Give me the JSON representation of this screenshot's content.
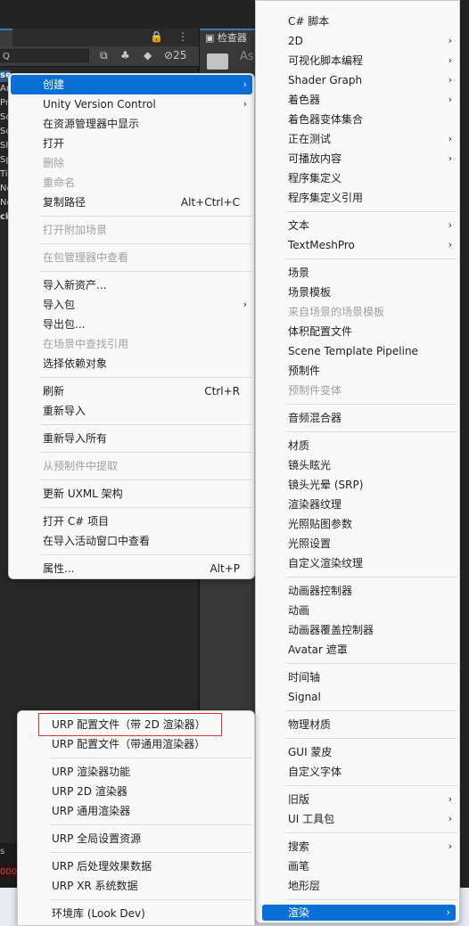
{
  "editor": {
    "inspector_tab": "检查器",
    "inspector_label": "As",
    "visible_count": "25",
    "bottom_text": "s",
    "error_text": "000"
  },
  "hierarchy": {
    "search_placeholder": "Q",
    "items": [
      "se",
      "Ar",
      "Pr",
      "Sc",
      "Sc",
      "Sh",
      "Sp",
      "Ti",
      "Ne",
      "Ne",
      "ck"
    ]
  },
  "context_menu": {
    "items": [
      {
        "label": "创建",
        "arrow": true,
        "highlight": true
      },
      {
        "label": "Unity Version Control",
        "arrow": true
      },
      {
        "label": "在资源管理器中显示"
      },
      {
        "label": "打开"
      },
      {
        "label": "删除",
        "disabled": true
      },
      {
        "label": "重命名",
        "disabled": true
      },
      {
        "label": "复制路径",
        "shortcut": "Alt+Ctrl+C"
      },
      {
        "label": "打开附加场景",
        "disabled": true
      },
      {
        "label": "在包管理器中查看",
        "disabled": true
      },
      {
        "label": "导入新资产..."
      },
      {
        "label": "导入包",
        "arrow": true
      },
      {
        "label": "导出包..."
      },
      {
        "label": "在场景中查找引用",
        "disabled": true
      },
      {
        "label": "选择依赖对象"
      },
      {
        "label": "刷新",
        "shortcut": "Ctrl+R"
      },
      {
        "label": "重新导入"
      },
      {
        "label": "重新导入所有"
      },
      {
        "label": "从预制件中提取",
        "disabled": true
      },
      {
        "label": "更新 UXML 架构"
      },
      {
        "label": "打开 C# 项目"
      },
      {
        "label": "在导入活动窗口中查看"
      },
      {
        "label": "属性...",
        "shortcut": "Alt+P"
      }
    ]
  },
  "create_menu": {
    "items": [
      {
        "label": "C# 脚本"
      },
      {
        "label": "2D",
        "arrow": true
      },
      {
        "label": "可视化脚本编程",
        "arrow": true
      },
      {
        "label": "Shader Graph",
        "arrow": true
      },
      {
        "label": "着色器",
        "arrow": true
      },
      {
        "label": "着色器变体集合"
      },
      {
        "label": "正在测试",
        "arrow": true
      },
      {
        "label": "可播放内容",
        "arrow": true
      },
      {
        "label": "程序集定义"
      },
      {
        "label": "程序集定义引用"
      },
      {
        "label": "文本",
        "arrow": true
      },
      {
        "label": "TextMeshPro",
        "arrow": true
      },
      {
        "label": "场景"
      },
      {
        "label": "场景模板"
      },
      {
        "label": "来自场景的场景模板",
        "disabled": true
      },
      {
        "label": "体积配置文件"
      },
      {
        "label": "Scene Template Pipeline"
      },
      {
        "label": "预制件"
      },
      {
        "label": "预制件变体",
        "disabled": true
      },
      {
        "label": "音频混合器"
      },
      {
        "label": "材质"
      },
      {
        "label": "镜头眩光"
      },
      {
        "label": "镜头光晕 (SRP)"
      },
      {
        "label": "渲染器纹理"
      },
      {
        "label": "光照贴图参数"
      },
      {
        "label": "光照设置"
      },
      {
        "label": "自定义渲染纹理"
      },
      {
        "label": "动画器控制器"
      },
      {
        "label": "动画"
      },
      {
        "label": "动画器覆盖控制器"
      },
      {
        "label": "Avatar 遮罩"
      },
      {
        "label": "时间轴"
      },
      {
        "label": "Signal"
      },
      {
        "label": "物理材质"
      },
      {
        "label": "GUI 蒙皮"
      },
      {
        "label": "自定义字体"
      },
      {
        "label": "旧版",
        "arrow": true
      },
      {
        "label": "UI 工具包",
        "arrow": true
      },
      {
        "label": "搜索",
        "arrow": true
      },
      {
        "label": "画笔"
      },
      {
        "label": "地形层"
      },
      {
        "label": "渲染",
        "arrow": true,
        "highlight": true
      }
    ]
  },
  "render_menu": {
    "items": [
      {
        "label": "URP 配置文件（带 2D 渲染器）",
        "outlined": true
      },
      {
        "label": "URP 配置文件（带通用渲染器）"
      },
      {
        "label": "URP 渲染器功能"
      },
      {
        "label": "URP 2D 渲染器"
      },
      {
        "label": "URP 通用渲染器"
      },
      {
        "label": "URP 全局设置资源"
      },
      {
        "label": "URP 后处理效果数据"
      },
      {
        "label": "URP XR 系统数据"
      },
      {
        "label": "环境库 (Look Dev)"
      }
    ]
  },
  "glyphs": {
    "arrow": "›"
  }
}
